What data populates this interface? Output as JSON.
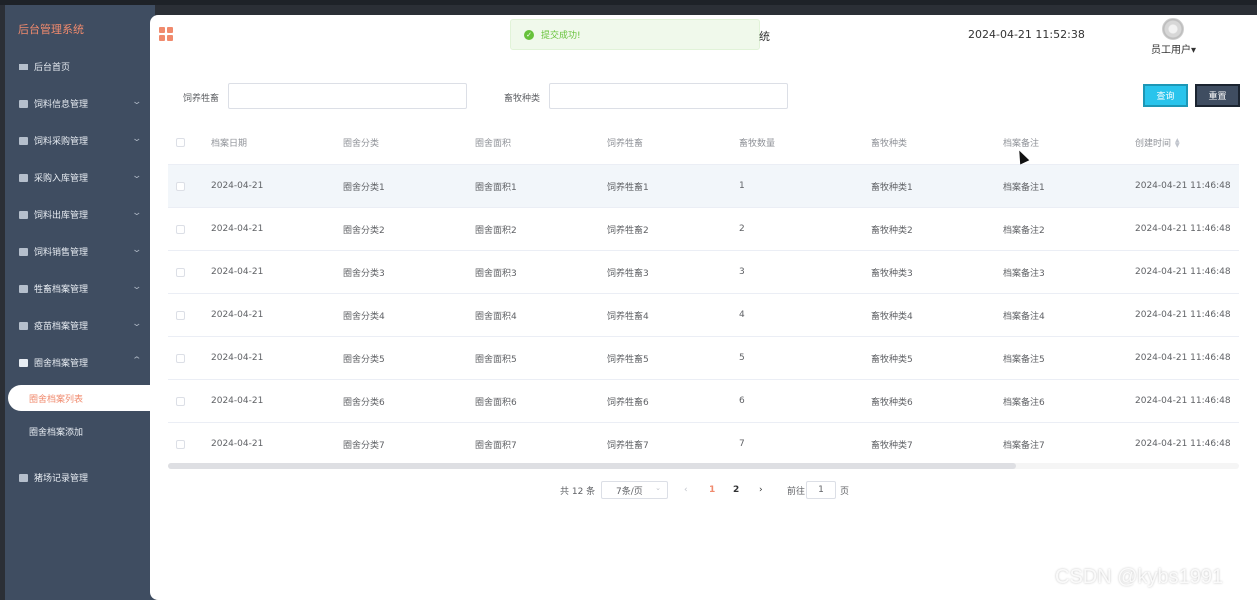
{
  "app": {
    "brand": "后台管理系统",
    "title_tail": "统"
  },
  "sidebar": {
    "items": [
      {
        "label": "后台首页",
        "icon": "monitor-icon",
        "chevron": ""
      },
      {
        "label": "饲料信息管理",
        "icon": "menu-icon",
        "chevron": "⌄"
      },
      {
        "label": "饲料采购管理",
        "icon": "menu-icon",
        "chevron": "⌄"
      },
      {
        "label": "采购入库管理",
        "icon": "menu-icon",
        "chevron": "⌄"
      },
      {
        "label": "饲料出库管理",
        "icon": "menu-icon",
        "chevron": "⌄"
      },
      {
        "label": "饲料销售管理",
        "icon": "menu-icon",
        "chevron": "⌄"
      },
      {
        "label": "牲畜档案管理",
        "icon": "menu-icon",
        "chevron": "⌄"
      },
      {
        "label": "疫苗档案管理",
        "icon": "menu-icon",
        "chevron": "⌄"
      },
      {
        "label": "圈舍档案管理",
        "icon": "menu-icon",
        "chevron": "⌃"
      }
    ],
    "submenu": {
      "active": "圈舍档案列表",
      "other": "圈舍档案添加"
    },
    "last_item": {
      "label": "猪场记录管理",
      "chevron": "⌄"
    }
  },
  "header": {
    "toast": "提交成功!",
    "datetime": "2024-04-21 11:52:38",
    "user": "员工用户",
    "user_caret": "▾"
  },
  "search": {
    "label1": "饲养牲畜",
    "value1": "",
    "label2": "畜牧种类",
    "value2": "",
    "query": "查询",
    "reset": "重置"
  },
  "table": {
    "headers": [
      "档案日期",
      "圈舍分类",
      "圈舍面积",
      "饲养牲畜",
      "畜牧数量",
      "畜牧种类",
      "档案备注",
      "创建时间"
    ],
    "rows": [
      [
        "2024-04-21",
        "圈舍分类1",
        "圈舍面积1",
        "饲养牲畜1",
        "1",
        "畜牧种类1",
        "档案备注1",
        "2024-04-21 11:46:48"
      ],
      [
        "2024-04-21",
        "圈舍分类2",
        "圈舍面积2",
        "饲养牲畜2",
        "2",
        "畜牧种类2",
        "档案备注2",
        "2024-04-21 11:46:48"
      ],
      [
        "2024-04-21",
        "圈舍分类3",
        "圈舍面积3",
        "饲养牲畜3",
        "3",
        "畜牧种类3",
        "档案备注3",
        "2024-04-21 11:46:48"
      ],
      [
        "2024-04-21",
        "圈舍分类4",
        "圈舍面积4",
        "饲养牲畜4",
        "4",
        "畜牧种类4",
        "档案备注4",
        "2024-04-21 11:46:48"
      ],
      [
        "2024-04-21",
        "圈舍分类5",
        "圈舍面积5",
        "饲养牲畜5",
        "5",
        "畜牧种类5",
        "档案备注5",
        "2024-04-21 11:46:48"
      ],
      [
        "2024-04-21",
        "圈舍分类6",
        "圈舍面积6",
        "饲养牲畜6",
        "6",
        "畜牧种类6",
        "档案备注6",
        "2024-04-21 11:46:48"
      ],
      [
        "2024-04-21",
        "圈舍分类7",
        "圈舍面积7",
        "饲养牲畜7",
        "7",
        "畜牧种类7",
        "档案备注7",
        "2024-04-21 11:46:48"
      ]
    ]
  },
  "pagination": {
    "total": "共 12 条",
    "page_size": "7条/页",
    "prev": "‹",
    "pages": [
      "1",
      "2"
    ],
    "next": "›",
    "goto_label": "前往",
    "goto_value": "1",
    "goto_unit": "页"
  },
  "watermark": "CSDN @kybs1991",
  "colors": {
    "accent": "#f08a6d",
    "sidebar": "#3f4d61",
    "query_button": "#29c4ec",
    "success": "#67c23a"
  }
}
